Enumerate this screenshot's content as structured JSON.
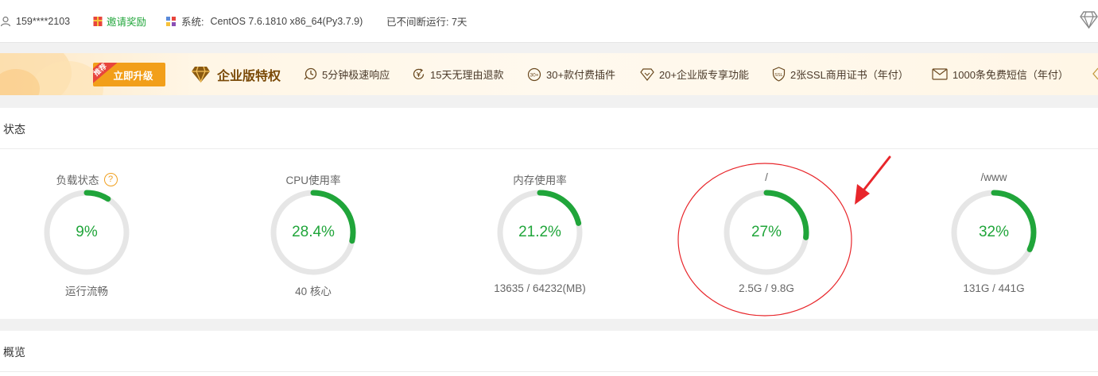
{
  "topbar": {
    "user": "159****2103",
    "invite": "邀请奖励",
    "system_label": "系统:",
    "system_value": "CentOS 7.6.1810 x86_64(Py3.7.9)",
    "uptime": "已不间断运行: 7天"
  },
  "banner": {
    "badge": "推荐",
    "upgrade_label": "立即升级",
    "title": "企业版特权",
    "features": [
      {
        "icon": "clock-lightning-icon",
        "label": "5分钟极速响应"
      },
      {
        "icon": "refund-icon",
        "label": "15天无理由退款"
      },
      {
        "icon": "plugin-30-icon",
        "label": "30+款付费插件"
      },
      {
        "icon": "diamond-outline-icon",
        "label": "20+企业版专享功能"
      },
      {
        "icon": "ssl-shield-icon",
        "label": "2张SSL商用证书（年付）"
      },
      {
        "icon": "mail-icon",
        "label": "1000条免费短信（年付）"
      }
    ]
  },
  "status": {
    "title": "状态",
    "gauges": [
      {
        "label": "负载状态",
        "value": "9%",
        "percent": 9,
        "sub": "运行流畅",
        "help": "?"
      },
      {
        "label": "CPU使用率",
        "value": "28.4%",
        "percent": 28.4,
        "sub": "40 核心"
      },
      {
        "label": "内存使用率",
        "value": "21.2%",
        "percent": 21.2,
        "sub": "13635 / 64232(MB)"
      },
      {
        "label": "/",
        "value": "27%",
        "percent": 27,
        "sub": "2.5G / 9.8G"
      },
      {
        "label": "/www",
        "value": "32%",
        "percent": 32,
        "sub": "131G / 441G"
      }
    ]
  },
  "overview": {
    "title": "概览"
  },
  "colors": {
    "accent": "#20a53a",
    "ring_track": "#e6e6e6",
    "annotation": "#e8262b",
    "upgrade": "#f29f1a"
  }
}
